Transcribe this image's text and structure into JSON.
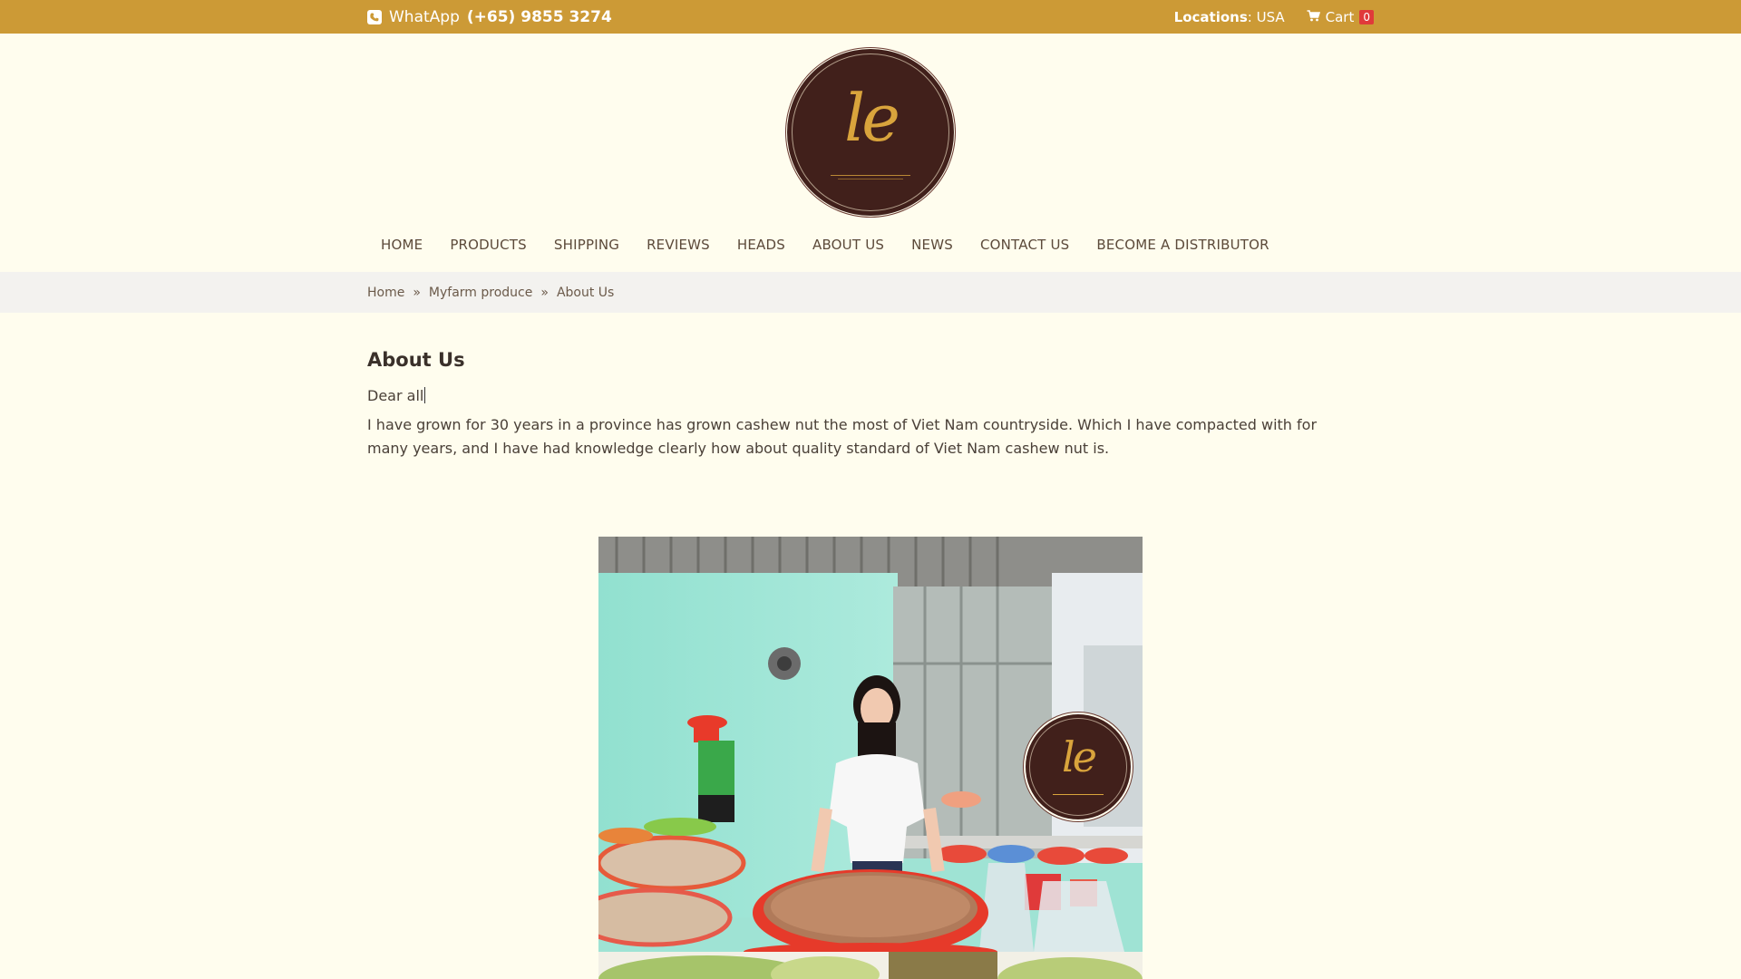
{
  "topbar": {
    "whatsapp_label": "WhatApp",
    "whatsapp_number": "(+65) 9855 3274",
    "locations_label": "Locations",
    "locations_value": ": USA",
    "cart_label": "Cart",
    "cart_count": "0",
    "bar_color": "#cc9a36"
  },
  "logo": {
    "text": "le"
  },
  "nav": {
    "items": [
      {
        "label": "HOME"
      },
      {
        "label": "PRODUCTS"
      },
      {
        "label": "SHIPPING"
      },
      {
        "label": "REVIEWS"
      },
      {
        "label": "HEADS"
      },
      {
        "label": "ABOUT US"
      },
      {
        "label": "NEWS"
      },
      {
        "label": "CONTACT US"
      },
      {
        "label": "BECOME A DISTRIBUTOR"
      }
    ]
  },
  "breadcrumb": {
    "items": [
      "Home",
      "Myfarm produce",
      "About Us"
    ],
    "separator": "»"
  },
  "content": {
    "title": "About Us",
    "greeting": "Dear all",
    "paragraph": "I have grown for 30 years in a province has grown cashew nut the most of Viet Nam countryside. Which I have compacted with for many years, and I have had knowledge clearly how about quality standard of Viet Nam cashew nut is."
  },
  "photo": {
    "watermark_text": "le"
  },
  "icons": {
    "whatsapp": "whatsapp-icon",
    "cart": "cart-icon"
  }
}
